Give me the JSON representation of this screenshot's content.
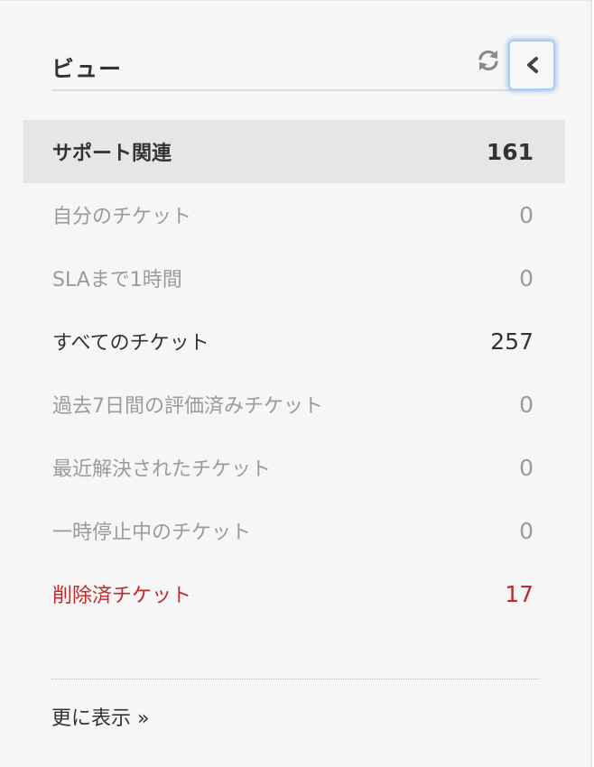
{
  "header": {
    "title": "ビュー"
  },
  "views": [
    {
      "label": "サポート関連",
      "count": "161",
      "state": "active"
    },
    {
      "label": "自分のチケット",
      "count": "0",
      "state": "muted"
    },
    {
      "label": "SLAまで1時間",
      "count": "0",
      "state": "muted"
    },
    {
      "label": "すべてのチケット",
      "count": "257",
      "state": "normal"
    },
    {
      "label": "過去7日間の評価済みチケット",
      "count": "0",
      "state": "muted"
    },
    {
      "label": "最近解決されたチケット",
      "count": "0",
      "state": "muted"
    },
    {
      "label": "一時停止中のチケット",
      "count": "0",
      "state": "muted"
    },
    {
      "label": "削除済チケット",
      "count": "17",
      "state": "danger"
    }
  ],
  "footer": {
    "more_label": "更に表示 »"
  },
  "icons": {
    "refresh": "refresh-icon",
    "collapse": "chevron-left-icon"
  },
  "colors": {
    "danger": "#bf2a2a",
    "muted": "#9b9b9b",
    "text": "#333333",
    "focus_ring": "#a9cdf3"
  }
}
